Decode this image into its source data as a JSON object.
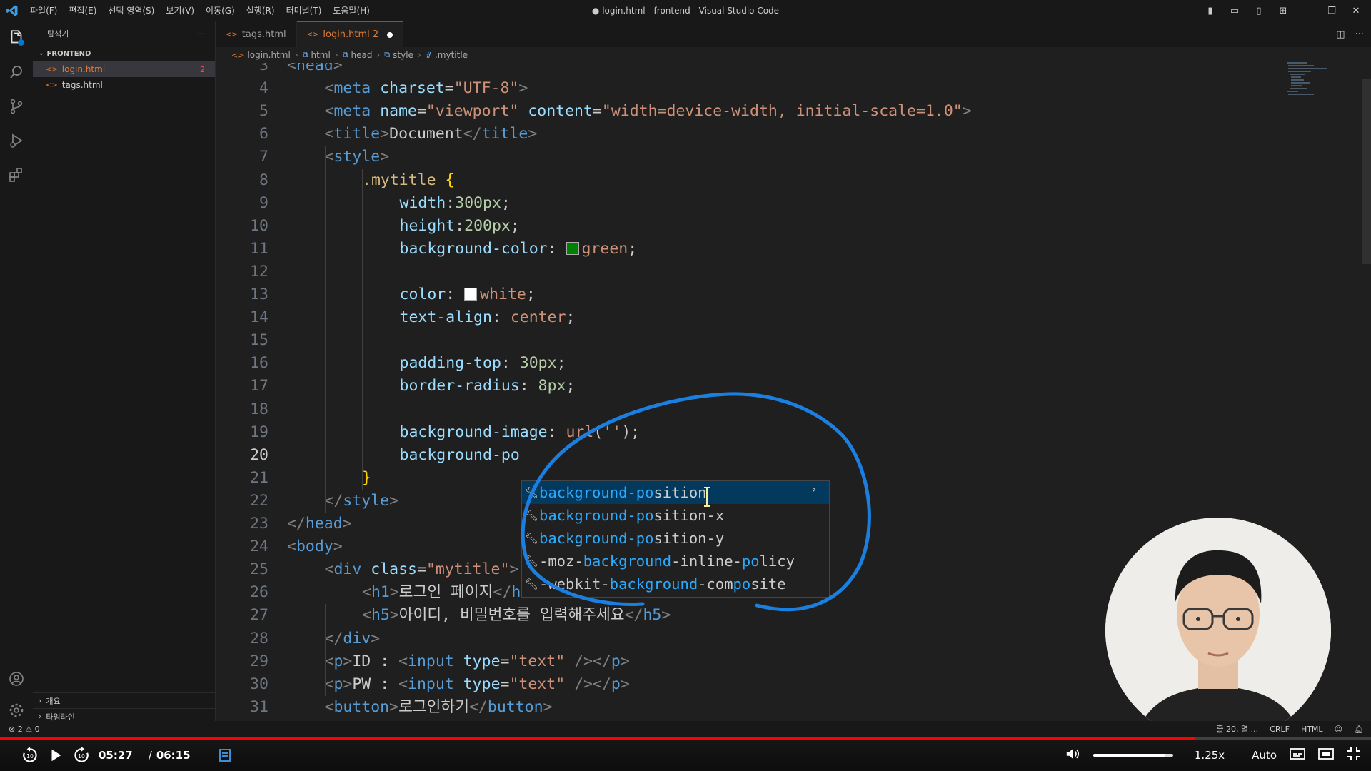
{
  "titlebar": {
    "menu": [
      "파일(F)",
      "편집(E)",
      "선택 영역(S)",
      "보기(V)",
      "이동(G)",
      "실행(R)",
      "터미널(T)",
      "도움말(H)"
    ],
    "window_title": "● login.html - frontend - Visual Studio Code"
  },
  "sidebar": {
    "title": "탐색기",
    "folder": "FRONTEND",
    "files": [
      {
        "name": "login.html",
        "badge": "2",
        "active": true
      },
      {
        "name": "tags.html",
        "badge": "",
        "active": false
      }
    ],
    "bottom_sections": [
      "개요",
      "타임라인"
    ]
  },
  "tabs": [
    {
      "label": "tags.html",
      "active": false
    },
    {
      "label": "login.html 2",
      "active": true,
      "modified": true
    }
  ],
  "breadcrumb": [
    "login.html",
    "html",
    "head",
    "style",
    ".mytitle"
  ],
  "editor": {
    "current_line": 20,
    "lines": [
      {
        "n": "3",
        "html": "<span class='t'>&lt;</span><span class='tag'>head</span><span class='t'>&gt;</span>",
        "indent": 0
      },
      {
        "n": "4",
        "html": "<span class='t'>&lt;</span><span class='tag'>meta</span> <span class='attr'>charset</span>=<span class='str'>\"UTF-8\"</span><span class='t'>&gt;</span>",
        "indent": 1
      },
      {
        "n": "5",
        "html": "<span class='t'>&lt;</span><span class='tag'>meta</span> <span class='attr'>name</span>=<span class='str'>\"viewport\"</span> <span class='attr'>content</span>=<span class='str'>\"width=device-width, initial-scale=1.0\"</span><span class='t'>&gt;</span>",
        "indent": 1
      },
      {
        "n": "6",
        "html": "<span class='t'>&lt;</span><span class='tag'>title</span><span class='t'>&gt;</span>Document<span class='t'>&lt;/</span><span class='tag'>title</span><span class='t'>&gt;</span>",
        "indent": 1
      },
      {
        "n": "7",
        "html": "<span class='t'>&lt;</span><span class='tag'>style</span><span class='t'>&gt;</span>",
        "indent": 1
      },
      {
        "n": "8",
        "html": "<span class='sel'>.mytitle</span> <span class='brace'>{</span>",
        "indent": 2
      },
      {
        "n": "9",
        "html": "<span class='prop'>width</span>:<span class='num'>300px</span>;",
        "indent": 3
      },
      {
        "n": "10",
        "html": "<span class='prop'>height</span>:<span class='num'>200px</span>;",
        "indent": 3
      },
      {
        "n": "11",
        "html": "<span class='prop'>background-color</span>: <span class='swatch' style='background:#008000'></span><span class='val'>green</span>;",
        "indent": 3
      },
      {
        "n": "12",
        "html": "",
        "indent": 3
      },
      {
        "n": "13",
        "html": "<span class='prop'>color</span>: <span class='swatch' style='background:#ffffff'></span><span class='val'>white</span>;",
        "indent": 3
      },
      {
        "n": "14",
        "html": "<span class='prop'>text-align</span>: <span class='val'>center</span>;",
        "indent": 3
      },
      {
        "n": "15",
        "html": "",
        "indent": 3
      },
      {
        "n": "16",
        "html": "<span class='prop'>padding-top</span>: <span class='num'>30px</span>;",
        "indent": 3
      },
      {
        "n": "17",
        "html": "<span class='prop'>border-radius</span>: <span class='num'>8px</span>;",
        "indent": 3
      },
      {
        "n": "18",
        "html": "",
        "indent": 3
      },
      {
        "n": "19",
        "html": "<span class='prop'>background-image</span>: <span class='val'>url</span>(<span class='str'>''</span>);",
        "indent": 3
      },
      {
        "n": "20",
        "html": "<span class='prop'>background-po</span>",
        "indent": 3
      },
      {
        "n": "21",
        "html": "<span class='brace'>}</span>",
        "indent": 2
      },
      {
        "n": "22",
        "html": "<span class='t'>&lt;/</span><span class='tag'>style</span><span class='t'>&gt;</span>",
        "indent": 1
      },
      {
        "n": "23",
        "html": "<span class='t'>&lt;/</span><span class='tag'>head</span><span class='t'>&gt;</span>",
        "indent": 0
      },
      {
        "n": "24",
        "html": "<span class='t'>&lt;</span><span class='tag'>body</span><span class='t'>&gt;</span>",
        "indent": 0
      },
      {
        "n": "25",
        "html": "<span class='t'>&lt;</span><span class='tag'>div</span> <span class='attr'>class</span>=<span class='str'>\"mytitle\"</span><span class='t'>&gt;</span>",
        "indent": 1
      },
      {
        "n": "26",
        "html": "<span class='t'>&lt;</span><span class='tag'>h1</span><span class='t'>&gt;</span>로그인 페이지<span class='t'>&lt;/</span><span class='tag'>h1</span><span class='t'>&gt;</span>",
        "indent": 2
      },
      {
        "n": "27",
        "html": "<span class='t'>&lt;</span><span class='tag'>h5</span><span class='t'>&gt;</span>아이디, 비밀번호를 입력해주세요<span class='t'>&lt;/</span><span class='tag'>h5</span><span class='t'>&gt;</span>",
        "indent": 2
      },
      {
        "n": "28",
        "html": "<span class='t'>&lt;/</span><span class='tag'>div</span><span class='t'>&gt;</span>",
        "indent": 1
      },
      {
        "n": "29",
        "html": "<span class='t'>&lt;</span><span class='tag'>p</span><span class='t'>&gt;</span>ID : <span class='t'>&lt;</span><span class='tag'>input</span> <span class='attr'>type</span>=<span class='str'>\"text\"</span> <span class='t'>/&gt;&lt;/</span><span class='tag'>p</span><span class='t'>&gt;</span>",
        "indent": 1
      },
      {
        "n": "30",
        "html": "<span class='t'>&lt;</span><span class='tag'>p</span><span class='t'>&gt;</span>PW : <span class='t'>&lt;</span><span class='tag'>input</span> <span class='attr'>type</span>=<span class='str'>\"text\"</span> <span class='t'>/&gt;&lt;/</span><span class='tag'>p</span><span class='t'>&gt;</span>",
        "indent": 1
      },
      {
        "n": "31",
        "html": "<span class='t'>&lt;</span><span class='tag'>button</span><span class='t'>&gt;</span>로그인하기<span class='t'>&lt;/</span><span class='tag'>button</span><span class='t'>&gt;</span>",
        "indent": 1
      }
    ]
  },
  "suggestions": [
    {
      "match": "background-po",
      "rest": "sition"
    },
    {
      "match": "background-po",
      "rest": "sition-x"
    },
    {
      "match": "background-po",
      "rest": "sition-y"
    },
    {
      "pre": "-moz-",
      "match": "background",
      "mid": "-inline-",
      "match2": "po",
      "rest": "licy"
    },
    {
      "pre": "-webkit-",
      "match": "background",
      "mid": "-com",
      "match2": "po",
      "rest": "site"
    }
  ],
  "annotation_color": "#1a7fe0",
  "statusbar": {
    "problems": "⊗ 2 ⚠ 0",
    "position": "줄 20, 열 ...",
    "eol": "CRLF",
    "language": "HTML"
  },
  "player": {
    "current_time": "05:27",
    "separator": "/",
    "duration": "06:15",
    "progress": 0.872,
    "speed": "1.25x",
    "quality": "Auto",
    "volume": 0.9
  }
}
